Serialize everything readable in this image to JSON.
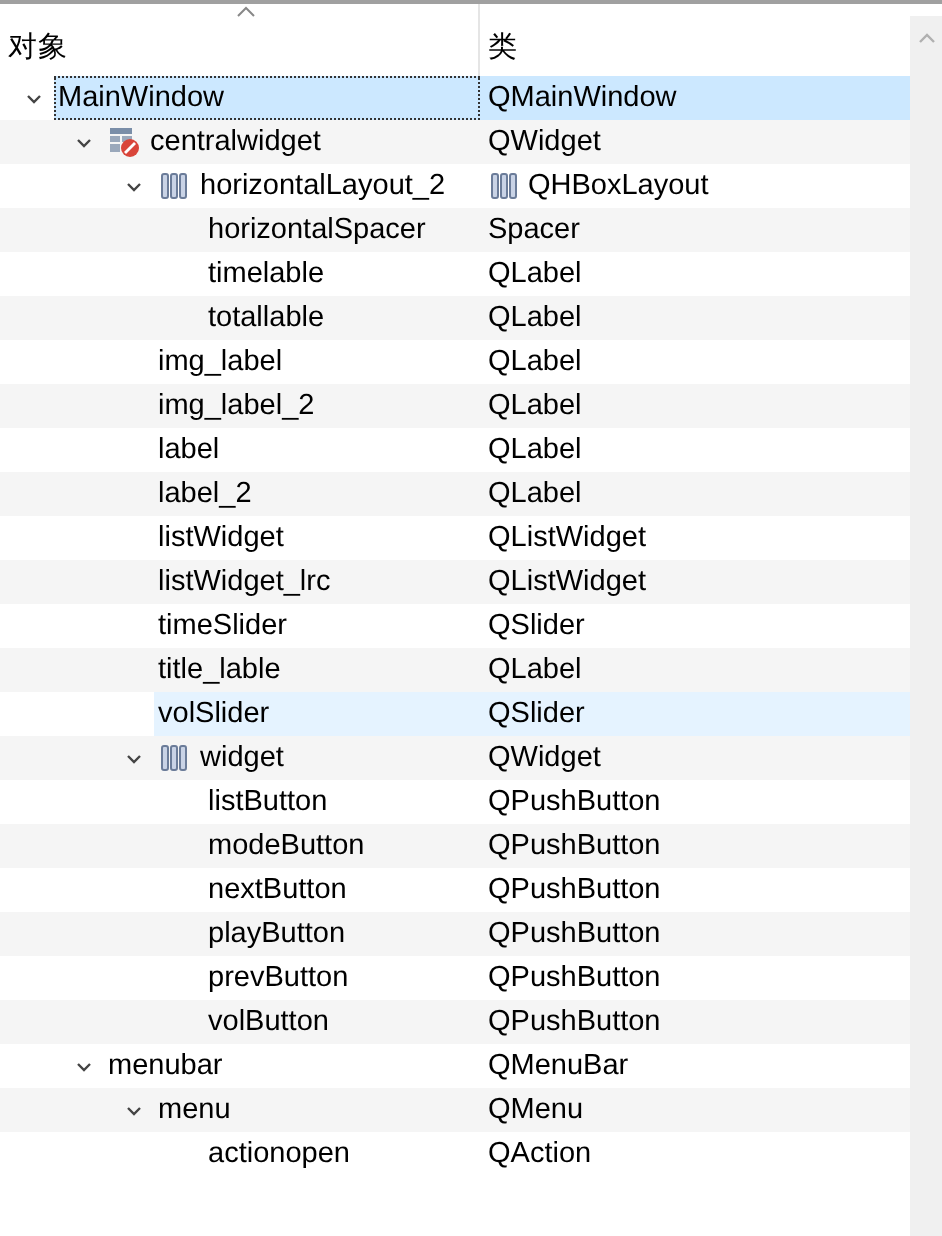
{
  "header": {
    "columns": [
      "对象",
      "类"
    ]
  },
  "tree": [
    {
      "name": "MainWindow",
      "class": "QMainWindow",
      "selected": true,
      "hovered": false,
      "expanded": true,
      "children": [
        {
          "name": "centralwidget",
          "class": "QWidget",
          "kind": "container",
          "selected": false,
          "hovered": false,
          "expanded": true,
          "children": [
            {
              "name": "horizontalLayout_2",
              "class": "QHBoxLayout",
              "kind": "layout",
              "selected": false,
              "hovered": false,
              "expanded": true,
              "children": [
                {
                  "name": "horizontalSpacer",
                  "class": "Spacer",
                  "selected": false,
                  "hovered": false
                },
                {
                  "name": "timelable",
                  "class": "QLabel",
                  "selected": false,
                  "hovered": false
                },
                {
                  "name": "totallable",
                  "class": "QLabel",
                  "selected": false,
                  "hovered": false
                }
              ]
            },
            {
              "name": "img_label",
              "class": "QLabel",
              "selected": false,
              "hovered": false
            },
            {
              "name": "img_label_2",
              "class": "QLabel",
              "selected": false,
              "hovered": false
            },
            {
              "name": "label",
              "class": "QLabel",
              "selected": false,
              "hovered": false
            },
            {
              "name": "label_2",
              "class": "QLabel",
              "selected": false,
              "hovered": false
            },
            {
              "name": "listWidget",
              "class": "QListWidget",
              "selected": false,
              "hovered": false
            },
            {
              "name": "listWidget_lrc",
              "class": "QListWidget",
              "selected": false,
              "hovered": false
            },
            {
              "name": "timeSlider",
              "class": "QSlider",
              "selected": false,
              "hovered": false
            },
            {
              "name": "title_lable",
              "class": "QLabel",
              "selected": false,
              "hovered": false
            },
            {
              "name": "volSlider",
              "class": "QSlider",
              "selected": false,
              "hovered": true
            },
            {
              "name": "widget",
              "class": "QWidget",
              "kind": "group",
              "selected": false,
              "hovered": false,
              "expanded": true,
              "children": [
                {
                  "name": "listButton",
                  "class": "QPushButton",
                  "selected": false,
                  "hovered": false
                },
                {
                  "name": "modeButton",
                  "class": "QPushButton",
                  "selected": false,
                  "hovered": false
                },
                {
                  "name": "nextButton",
                  "class": "QPushButton",
                  "selected": false,
                  "hovered": false
                },
                {
                  "name": "playButton",
                  "class": "QPushButton",
                  "selected": false,
                  "hovered": false
                },
                {
                  "name": "prevButton",
                  "class": "QPushButton",
                  "selected": false,
                  "hovered": false
                },
                {
                  "name": "volButton",
                  "class": "QPushButton",
                  "selected": false,
                  "hovered": false
                }
              ]
            }
          ]
        },
        {
          "name": "menubar",
          "class": "QMenuBar",
          "selected": false,
          "hovered": false,
          "expanded": true,
          "children": [
            {
              "name": "menu",
              "class": "QMenu",
              "selected": false,
              "hovered": false,
              "expanded": true,
              "children": [
                {
                  "name": "actionopen",
                  "class": "QAction",
                  "selected": false,
                  "hovered": false
                }
              ]
            }
          ]
        }
      ]
    }
  ]
}
